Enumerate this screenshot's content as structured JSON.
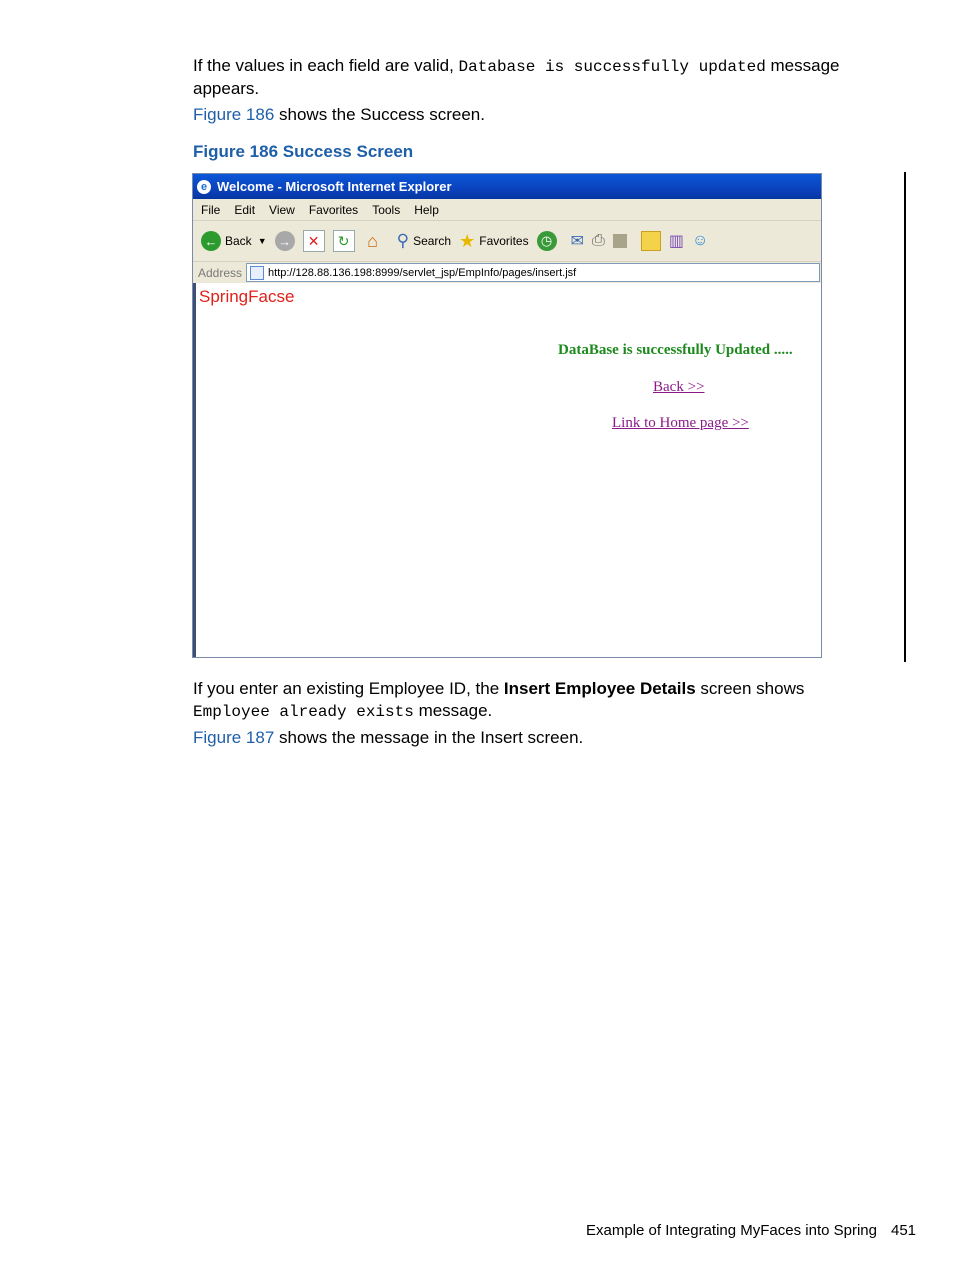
{
  "para1": {
    "text_before": "If the values in each field are valid, ",
    "code": "Database is successfully updated",
    "text_after": " message appears."
  },
  "para2": {
    "link": "Figure 186",
    "text": " shows the Success screen."
  },
  "caption": "Figure 186 Success Screen",
  "screenshot": {
    "title": "Welcome - Microsoft Internet Explorer",
    "menu": [
      "File",
      "Edit",
      "View",
      "Favorites",
      "Tools",
      "Help"
    ],
    "toolbar": {
      "back": "Back",
      "search": "Search",
      "favorites": "Favorites"
    },
    "address_label": "Address",
    "address_url": "http://128.88.136.198:8999/servlet_jsp/EmpInfo/pages/insert.jsf",
    "brand": "SpringFacse",
    "success_message": "DataBase is successfully Updated .....",
    "back_link": "Back >>",
    "home_link": "Link to Home page >>"
  },
  "para3": {
    "text_before": "If you enter an existing Employee ID, the ",
    "bold": "Insert Employee Details",
    "text_mid": " screen shows ",
    "code": "Employee already exists",
    "text_after": " message."
  },
  "para4": {
    "link": "Figure 187",
    "text": " shows the message in the Insert screen."
  },
  "footer": {
    "title": "Example of Integrating MyFaces into Spring",
    "page": "451"
  }
}
